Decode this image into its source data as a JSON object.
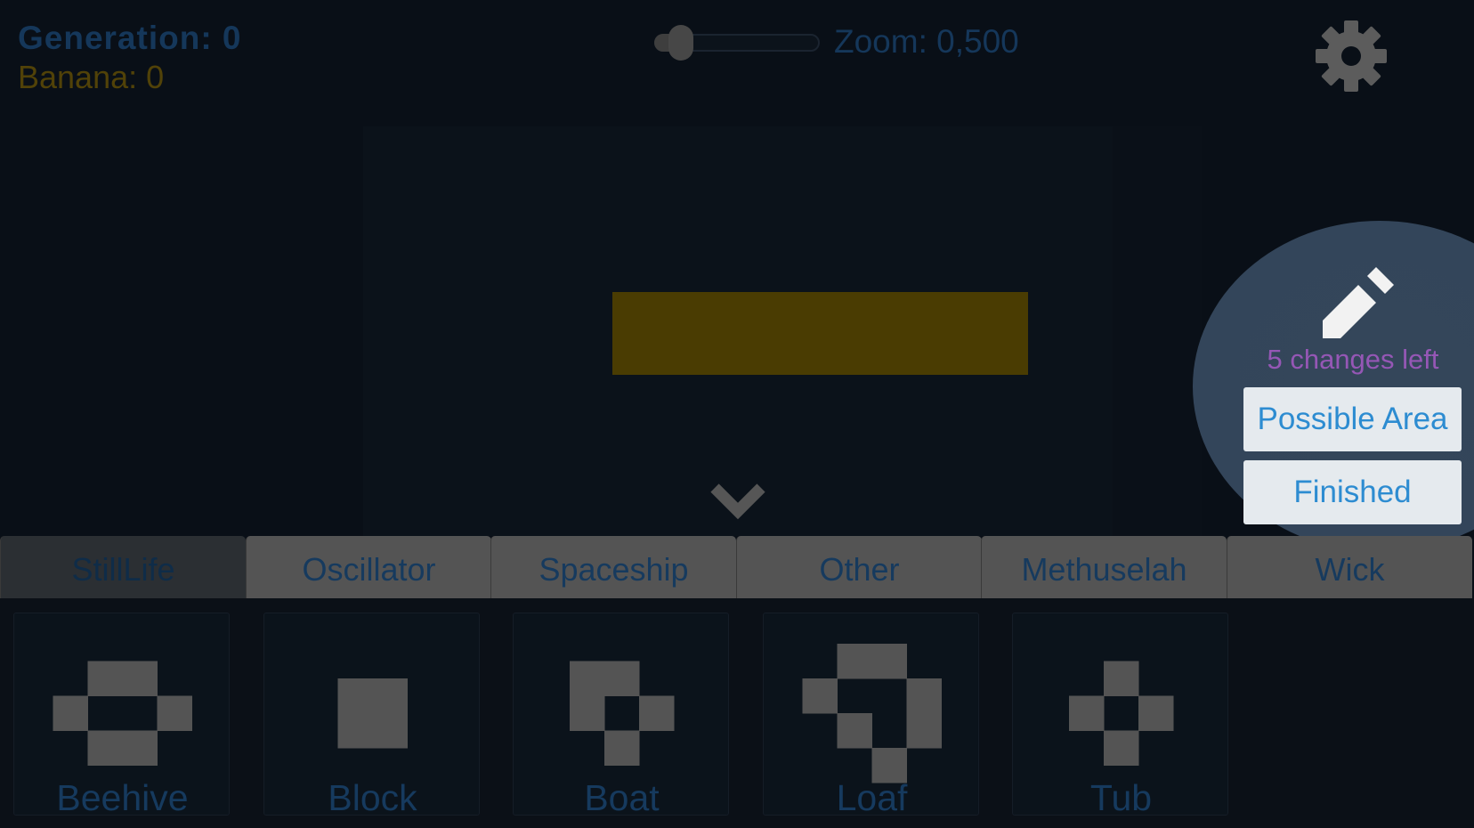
{
  "hud": {
    "generation": "Generation: 0",
    "banana": "Banana: 0"
  },
  "zoom": {
    "label": "Zoom: 0,500",
    "slider_level": 0.1
  },
  "settings": {
    "icon": "gear-icon"
  },
  "edit_panel": {
    "icon": "pencil-icon",
    "changes_left": "5 changes left",
    "possible_area_label": "Possible Area",
    "finished_label": "Finished"
  },
  "tabs": [
    {
      "label": "StillLife",
      "active": true
    },
    {
      "label": "Oscillator",
      "active": false
    },
    {
      "label": "Spaceship",
      "active": false
    },
    {
      "label": "Other",
      "active": false
    },
    {
      "label": "Methuselah",
      "active": false
    },
    {
      "label": "Wick",
      "active": false
    }
  ],
  "patterns": [
    {
      "name": "Beehive",
      "cells": [
        [
          0,
          1
        ],
        [
          0,
          2
        ],
        [
          1,
          0
        ],
        [
          1,
          3
        ],
        [
          2,
          1
        ],
        [
          2,
          2
        ]
      ],
      "rows": 3,
      "cols": 4
    },
    {
      "name": "Block",
      "cells": [
        [
          0,
          0
        ],
        [
          0,
          1
        ],
        [
          1,
          0
        ],
        [
          1,
          1
        ]
      ],
      "rows": 2,
      "cols": 2
    },
    {
      "name": "Boat",
      "cells": [
        [
          0,
          0
        ],
        [
          0,
          1
        ],
        [
          1,
          0
        ],
        [
          1,
          2
        ],
        [
          2,
          1
        ]
      ],
      "rows": 3,
      "cols": 3
    },
    {
      "name": "Loaf",
      "cells": [
        [
          0,
          1
        ],
        [
          0,
          2
        ],
        [
          1,
          0
        ],
        [
          1,
          3
        ],
        [
          2,
          1
        ],
        [
          2,
          3
        ],
        [
          3,
          2
        ]
      ],
      "rows": 4,
      "cols": 4
    },
    {
      "name": "Tub",
      "cells": [
        [
          0,
          1
        ],
        [
          1,
          0
        ],
        [
          1,
          2
        ],
        [
          2,
          1
        ]
      ],
      "rows": 3,
      "cols": 3
    }
  ],
  "colors": {
    "background": "#090f17",
    "live_cell": "#4a3c02",
    "pattern_cell": "#545454",
    "accent_blue": "#2d8cd1",
    "purple": "#9557b5"
  }
}
